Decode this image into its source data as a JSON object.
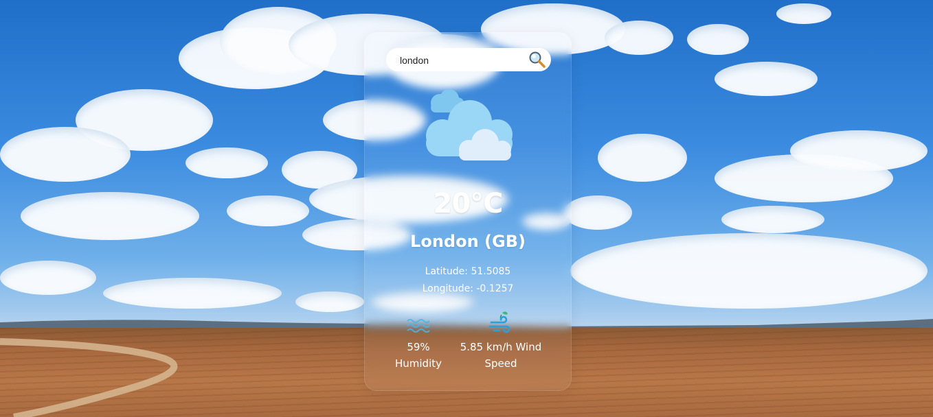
{
  "search": {
    "value": "london",
    "placeholder": ""
  },
  "weather": {
    "icon": "cloudy-icon",
    "temperature": "20°C",
    "city": "London (GB)",
    "latitude": "Latitude: 51.5085",
    "longitude": "Longitude: -0.1257"
  },
  "stats": {
    "humidity_value": "59%",
    "humidity_label": "Humidity",
    "wind_value": "5.85 km/h Wind",
    "wind_label": "Speed",
    "humidity_icon": "waves-icon",
    "wind_icon": "wind-icon"
  },
  "colors": {
    "sky": "#2f7fd8",
    "ground": "#a8693f",
    "text": "#ffffff"
  }
}
